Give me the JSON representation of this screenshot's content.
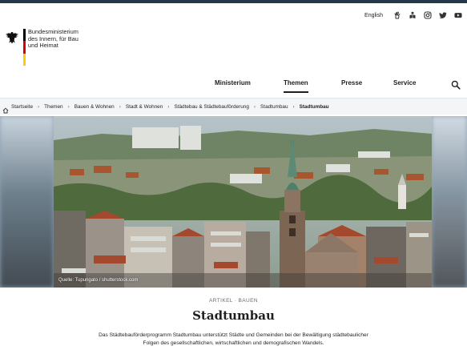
{
  "header": {
    "utility": {
      "language_link": "English",
      "icons": [
        "sign-language-icon",
        "easy-language-icon",
        "instagram-icon",
        "twitter-icon",
        "youtube-icon"
      ]
    },
    "logo": {
      "ministry_name_lines": [
        "Bundesministerium",
        "des Innern, für Bau",
        "und Heimat"
      ],
      "flag_colors": [
        "#000000",
        "#dd0000",
        "#ffcc00"
      ]
    },
    "nav": {
      "items": [
        {
          "label": "Ministerium"
        },
        {
          "label": "Themen",
          "active": true
        },
        {
          "label": "Presse"
        },
        {
          "label": "Service"
        }
      ],
      "search_icon": "search-icon"
    }
  },
  "breadcrumb": {
    "home_icon": "home-icon",
    "items": [
      "Startseite",
      "Themen",
      "Bauen & Wohnen",
      "Stadt & Wohnen",
      "Städtebau & Städtebauförderung",
      "Stadtumbau",
      "Stadtumbau"
    ]
  },
  "hero": {
    "image_credit": "Quelle: Tupungato / shutterstock.com"
  },
  "article": {
    "kicker": "ARTIKEL · BAUEN",
    "title": "Stadtumbau",
    "lead_lines": [
      "Das Städtebauförderprogramm Stadtumbau unterstützt Städte und Gemeinden bei der Bewältigung städtebaulicher",
      "Folgen des gesellschaftlichen, wirtschaftlichen und demografischen Wandels."
    ]
  },
  "colors": {
    "topbar": "#26364d",
    "breadcrumb_bg": "#f3f5f7",
    "text": "#1f1f1f"
  }
}
